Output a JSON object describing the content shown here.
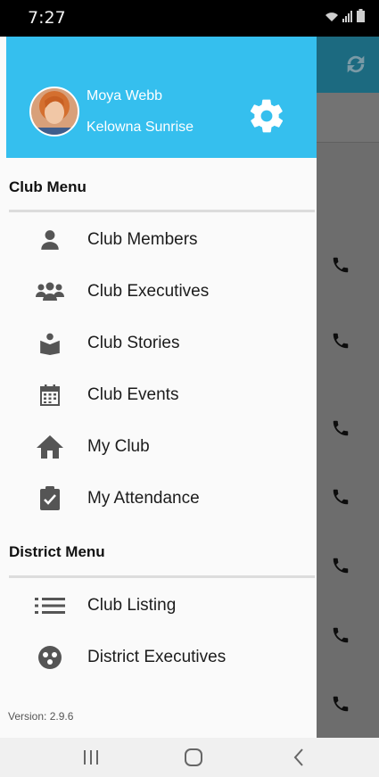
{
  "status_bar": {
    "time": "7:27"
  },
  "drawer": {
    "user": {
      "name": "Moya Webb",
      "club": "Kelowna Sunrise"
    },
    "club_menu": {
      "title": "Club Menu",
      "items": [
        {
          "label": "Club Members",
          "icon": "person-icon"
        },
        {
          "label": "Club Executives",
          "icon": "group-icon"
        },
        {
          "label": "Club Stories",
          "icon": "reading-icon"
        },
        {
          "label": "Club Events",
          "icon": "calendar-icon"
        },
        {
          "label": "My Club",
          "icon": "home-icon"
        },
        {
          "label": "My Attendance",
          "icon": "clipboard-check-icon"
        }
      ]
    },
    "district_menu": {
      "title": "District Menu",
      "items": [
        {
          "label": "Club Listing",
          "icon": "list-icon"
        },
        {
          "label": "District Executives",
          "icon": "district-icon"
        }
      ]
    },
    "version": "Version: 2.9.6"
  },
  "colors": {
    "header": "#35bfee",
    "background_header": "#1c6a80"
  }
}
